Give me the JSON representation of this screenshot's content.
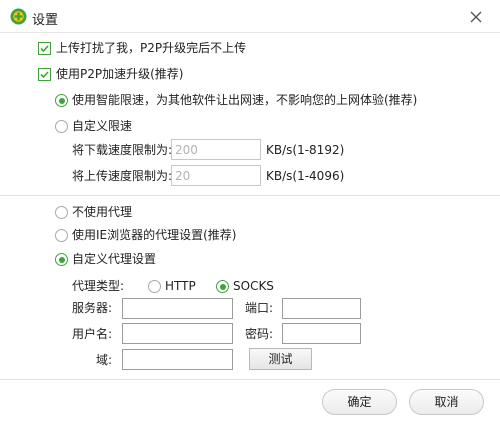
{
  "window": {
    "title": "设置",
    "accent_color": "#3fa33a",
    "logo_color": "#f5c518"
  },
  "upload": {
    "checkbox1_label": "上传打扰了我，P2P升级完后不上传",
    "checkbox1_checked": true,
    "checkbox2_label": "使用P2P加速升级(推荐)",
    "checkbox2_checked": true
  },
  "speed": {
    "smart_label": "使用智能限速，为其他软件让出网速，不影响您的上网体验(推荐)",
    "custom_label": "自定义限速",
    "download_label": "将下载速度限制为:",
    "download_value": "200",
    "download_unit": "KB/s(1-8192)",
    "upload_label": "将上传速度限制为:",
    "upload_value": "20",
    "upload_unit": "KB/s(1-4096)"
  },
  "proxy": {
    "none_label": "不使用代理",
    "ie_label": "使用IE浏览器的代理设置(推荐)",
    "custom_label": "自定义代理设置",
    "type_label": "代理类型:",
    "http_label": "HTTP",
    "socks_label": "SOCKS",
    "server_label": "服务器:",
    "port_label": "端口:",
    "username_label": "用户名:",
    "password_label": "密码:",
    "domain_label": "域:",
    "test_button": "测试"
  },
  "footer": {
    "ok_button": "确定",
    "cancel_button": "取消"
  }
}
